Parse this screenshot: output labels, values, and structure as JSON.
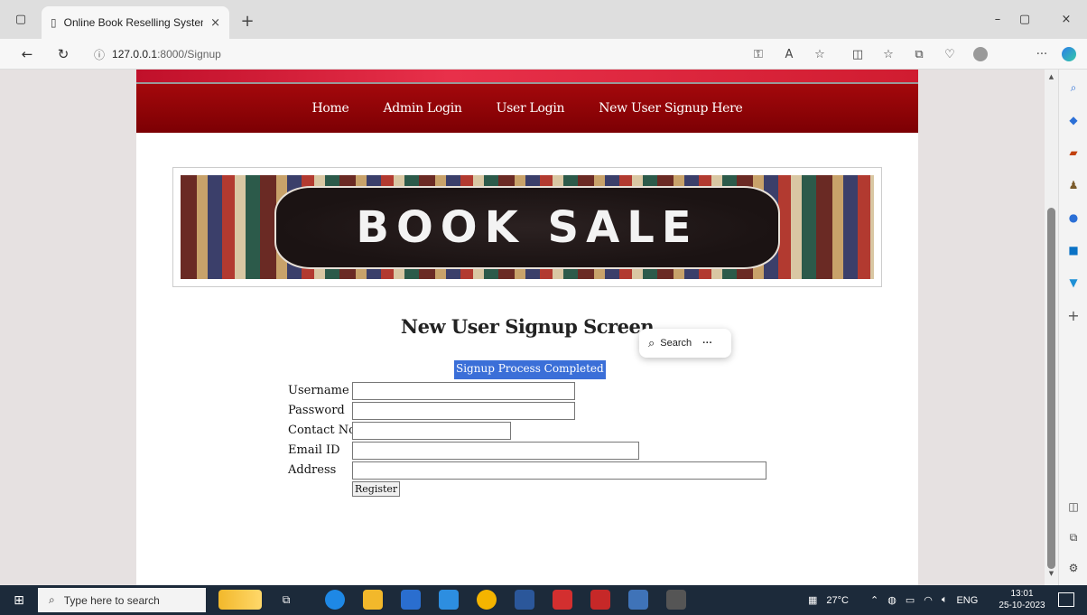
{
  "browser": {
    "tab_title": "Online Book Reselling System",
    "tab_close": "×",
    "new_tab": "+",
    "url_host": "127.0.0.1",
    "url_path": ":8000/Signup",
    "window_controls": {
      "minimize": "–",
      "restore": "▢",
      "close": "×"
    }
  },
  "site": {
    "nav": [
      "Home",
      "Admin Login",
      "User Login",
      "New User Signup Here"
    ],
    "banner_text": "BOOK SALE",
    "heading": "New User Signup Screen",
    "status_message": "Signup Process Completed",
    "form": {
      "username_label": "Username",
      "password_label": "Password",
      "contact_label": "Contact No",
      "email_label": "Email ID",
      "address_label": "Address",
      "username_value": "",
      "password_value": "",
      "contact_value": "",
      "email_value": "",
      "address_value": "",
      "register_label": "Register"
    }
  },
  "popup": {
    "search_label": "Search",
    "more": "···"
  },
  "taskbar": {
    "search_placeholder": "Type here to search",
    "weather": "27°C",
    "language": "ENG",
    "time": "13:01",
    "date": "25-10-2023"
  },
  "colors": {
    "menu_bg": "#8e0406",
    "status_bg": "#3b6fd8",
    "taskbar_bg": "#1c2a3a"
  }
}
